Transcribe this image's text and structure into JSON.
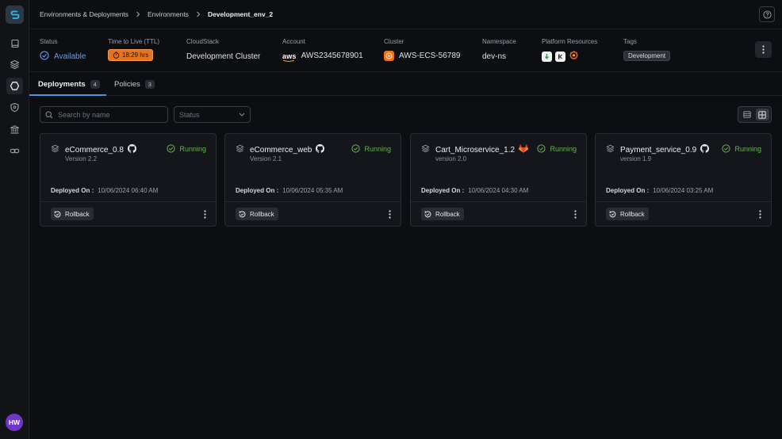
{
  "sidebar": {
    "items": [
      {
        "name": "book"
      },
      {
        "name": "layers"
      },
      {
        "name": "environments",
        "active": true
      },
      {
        "name": "shield"
      },
      {
        "name": "bank"
      },
      {
        "name": "link"
      }
    ],
    "avatar": "HW"
  },
  "breadcrumb": [
    "Environments & Deployments",
    "Environments",
    "Development_env_2"
  ],
  "info": {
    "status_label": "Status",
    "status_value": "Available",
    "ttl_label": "Time to Live (TTL)",
    "ttl_value": "18:29 hrs",
    "cloudstack_label": "CloudStack",
    "cloudstack_value": "Development Cluster",
    "account_label": "Account",
    "account_value": "AWS2345678901",
    "account_logo": "aws",
    "cluster_label": "Cluster",
    "cluster_value": "AWS-ECS-56789",
    "namespace_label": "Namespace",
    "namespace_value": "dev-ns",
    "platform_label": "Platform Resources",
    "tags_label": "Tags",
    "tag": "Development"
  },
  "tabs": [
    {
      "label": "Deployments",
      "count": "4",
      "active": true
    },
    {
      "label": "Policies",
      "count": "3",
      "active": false
    }
  ],
  "filters": {
    "search_placeholder": "Search by name",
    "status_placeholder": "Status"
  },
  "deployments": [
    {
      "name": "eCommerce_0.8",
      "repo_icon": "github-icon",
      "version": "Version 2.2",
      "status": "Running",
      "deployed_label": "Deployed On :",
      "deployed_on": "10/06/2024 06:40 AM",
      "rollback": "Rollback"
    },
    {
      "name": "eCommerce_web",
      "repo_icon": "github-icon",
      "version": "Version 2.1",
      "status": "Running",
      "deployed_label": "Deployed On :",
      "deployed_on": "10/06/2024 05:35 AM",
      "rollback": "Rollback"
    },
    {
      "name": "Cart_Microservice_1.2",
      "repo_icon": "gitlab-icon",
      "version": "version 2.0",
      "status": "Running",
      "deployed_label": "Deployed On :",
      "deployed_on": "10/06/2024 04:30 AM",
      "rollback": "Rollback"
    },
    {
      "name": "Payment_service_0.9",
      "repo_icon": "github-icon",
      "version": "version 1.9",
      "status": "Running",
      "deployed_label": "Deployed On :",
      "deployed_on": "10/06/2024 03:25 AM",
      "rollback": "Rollback"
    }
  ],
  "colors": {
    "accent": "#4c92e6",
    "running": "#62b54a",
    "ttl": "#e6731e",
    "cluster": "#e8731c"
  }
}
